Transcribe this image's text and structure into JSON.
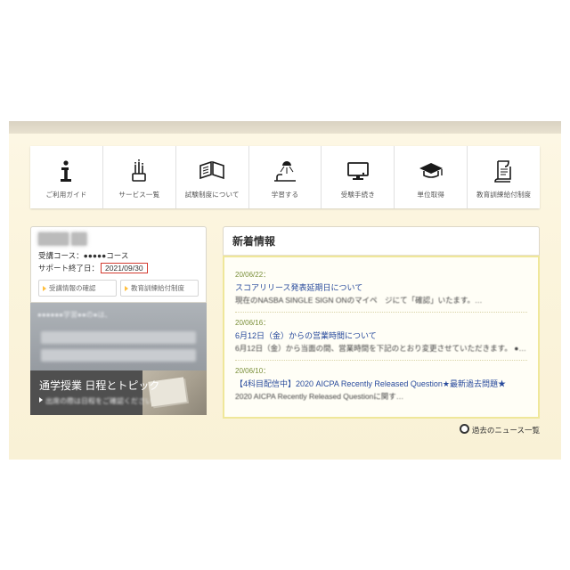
{
  "nav": [
    {
      "id": "guide",
      "label": "ご利用ガイド"
    },
    {
      "id": "services",
      "label": "サービス一覧"
    },
    {
      "id": "exam",
      "label": "試験制度について"
    },
    {
      "id": "study",
      "label": "学習する"
    },
    {
      "id": "procedure",
      "label": "受験手続き"
    },
    {
      "id": "credits",
      "label": "単位取得"
    },
    {
      "id": "benefits",
      "label": "教育訓練給付制度"
    }
  ],
  "left": {
    "course_line": "受講コース：●●●●●コース",
    "support_label": "サポート終了日：",
    "support_date": "2021/09/30",
    "btn1": "受講情報の確認",
    "btn2": "教育訓練給付制度",
    "mid_line": "●●●●●●学習●●の●は、",
    "bottom_title": "通学授業 日程とトピック",
    "bottom_sub": "出席の際は日程をご確認ください"
  },
  "news": {
    "title": "新着情報",
    "items": [
      {
        "date": "20/06/22：",
        "title": "スコアリリース発表延期日について",
        "summary": "現在のNASBA SINGLE SIGN ONのマイペ　ジにて「確認」いたます。…"
      },
      {
        "date": "20/06/16：",
        "title": "6月12日（金）からの営業時間について",
        "summary": "6月12日（金）から当面の間、営業時間を下記のとおり変更させていただきます。 ●…"
      },
      {
        "date": "20/06/10：",
        "title": "【4科目配信中】2020 AICPA Recently Released Question★最新過去問題★",
        "summary": "2020 AICPA Recently Released Questionに関す…"
      }
    ],
    "more": "過去のニュース一覧"
  }
}
